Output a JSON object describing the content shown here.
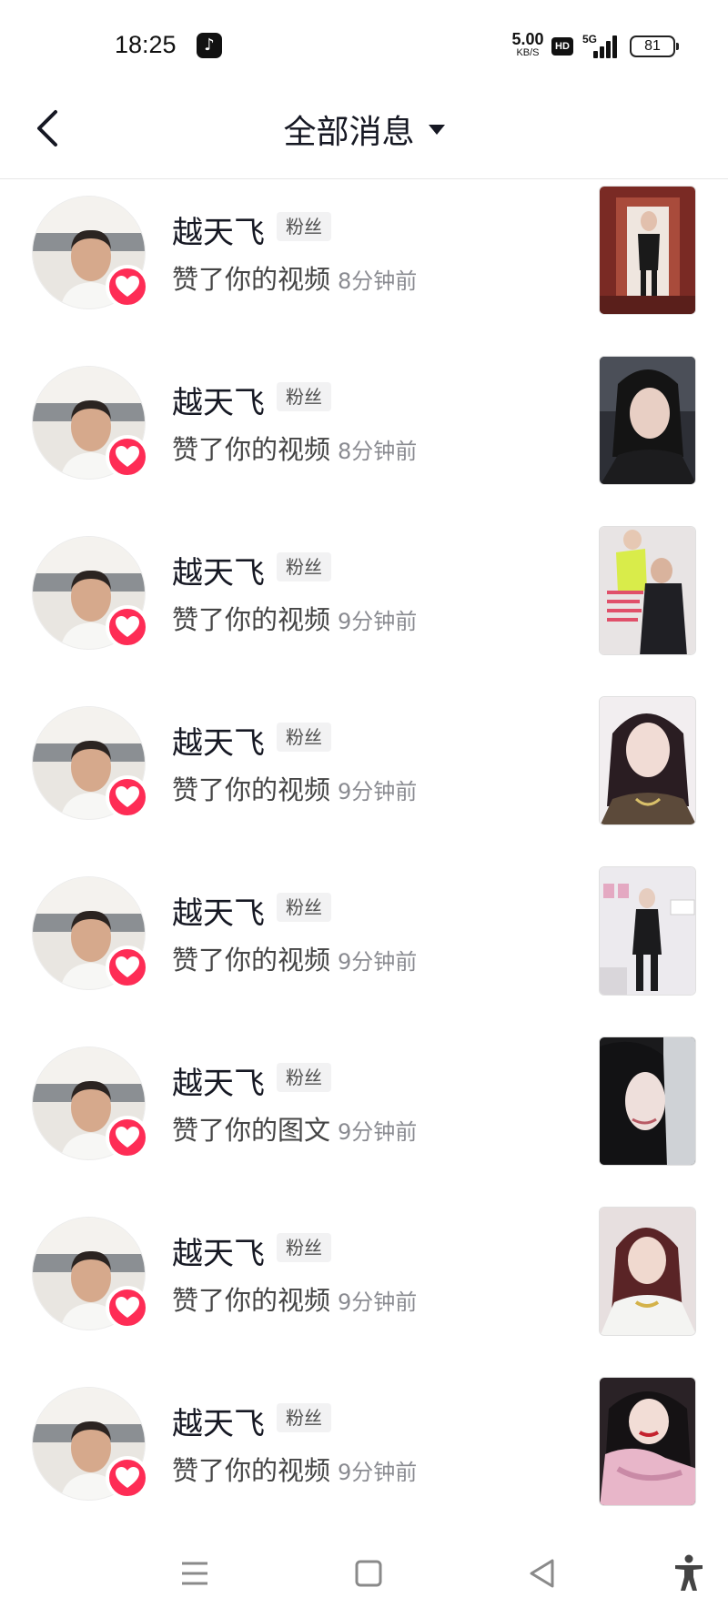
{
  "status_bar": {
    "time": "18:25",
    "net_speed_value": "5.00",
    "net_speed_unit": "KB/S",
    "hd_badge": "HD",
    "network_type": "5G",
    "battery_level": "81"
  },
  "header": {
    "title": "全部消息"
  },
  "notifications": [
    {
      "name": "越天飞",
      "tag": "粉丝",
      "action": "赞了你的视频",
      "time": "8分钟前"
    },
    {
      "name": "越天飞",
      "tag": "粉丝",
      "action": "赞了你的视频",
      "time": "8分钟前"
    },
    {
      "name": "越天飞",
      "tag": "粉丝",
      "action": "赞了你的视频",
      "time": "9分钟前"
    },
    {
      "name": "越天飞",
      "tag": "粉丝",
      "action": "赞了你的视频",
      "time": "9分钟前"
    },
    {
      "name": "越天飞",
      "tag": "粉丝",
      "action": "赞了你的视频",
      "time": "9分钟前"
    },
    {
      "name": "越天飞",
      "tag": "粉丝",
      "action": "赞了你的图文",
      "time": "9分钟前"
    },
    {
      "name": "越天飞",
      "tag": "粉丝",
      "action": "赞了你的视频",
      "time": "9分钟前"
    },
    {
      "name": "越天飞",
      "tag": "粉丝",
      "action": "赞了你的视频",
      "time": "9分钟前"
    }
  ],
  "colors": {
    "like_accent": "#fe2c55",
    "text_primary": "#161823",
    "text_secondary": "#8a8b91"
  },
  "icons": {
    "back": "chevron-left-icon",
    "dropdown": "caret-down-icon",
    "like": "heart-icon",
    "nav_menu": "menu-icon",
    "nav_home": "square-icon",
    "nav_back": "triangle-back-icon",
    "accessibility": "accessibility-icon"
  }
}
